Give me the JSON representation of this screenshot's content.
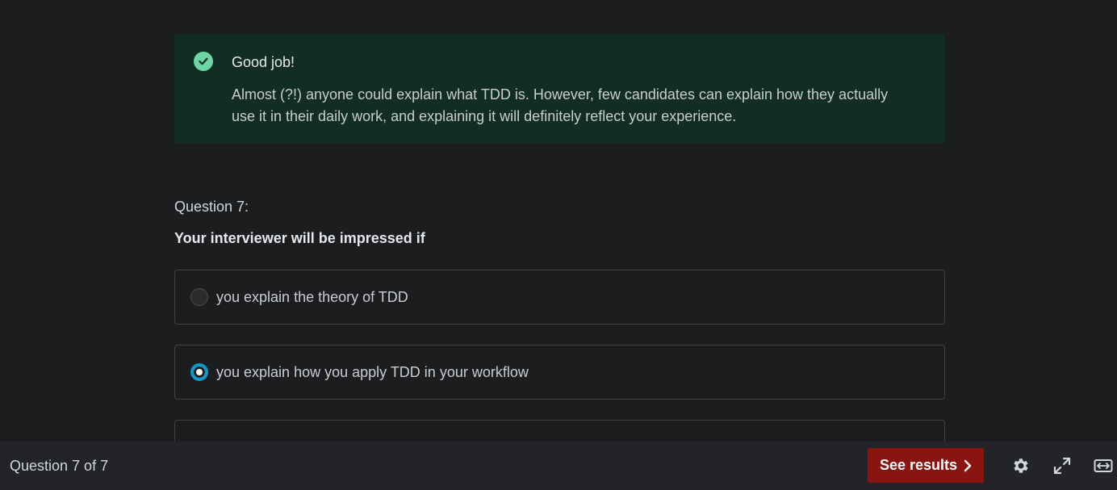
{
  "feedback": {
    "title": "Good job!",
    "body": "Almost (?!) anyone could explain what TDD is. However, few candidates can explain how they actually use it in their daily work, and explaining it will definitely reflect your experience.",
    "icon": "check-circle-icon",
    "color": "#6dd6a4"
  },
  "question": {
    "number_label": "Question 7:",
    "text": "Your interviewer will be impressed if",
    "options": [
      {
        "label": "you explain the theory of TDD",
        "selected": false
      },
      {
        "label": "you explain how you apply TDD in your workflow",
        "selected": true
      }
    ]
  },
  "footer": {
    "progress": "Question 7 of 7",
    "results_label": "See results",
    "results_color": "#8a1410",
    "icons": [
      "gear-icon",
      "expand-icon",
      "widescreen-icon"
    ]
  }
}
